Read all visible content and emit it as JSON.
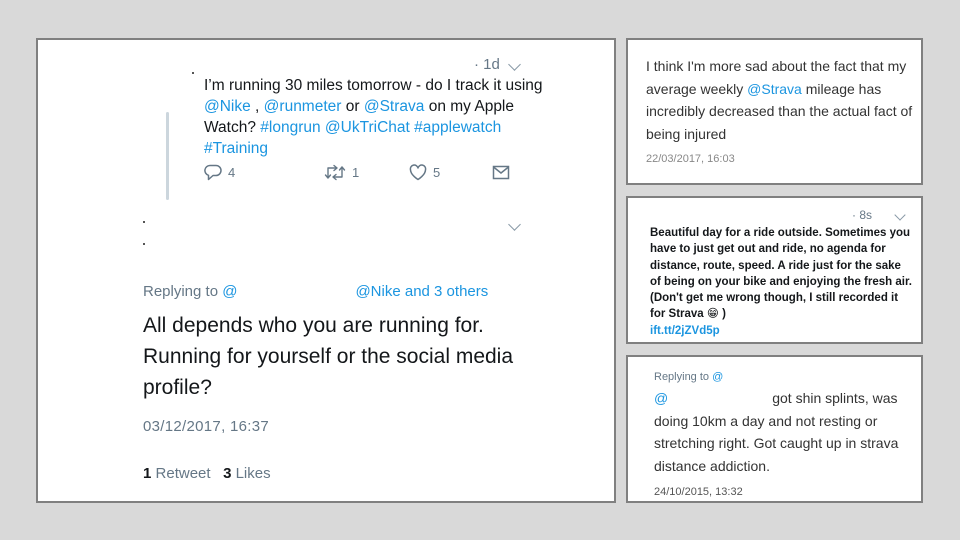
{
  "main": {
    "quoted": {
      "time": "· 1d",
      "text_1": "I’m running 30 miles tomorrow - do I track it using ",
      "mention_nike": "@Nike",
      "text_2": " , ",
      "mention_runmeter": "@runmeter",
      "text_3": " or ",
      "mention_strava": "@Strava",
      "text_4": " on my Apple Watch? ",
      "hashtag_longrun": "#longrun",
      "text_5": " ",
      "mention_uktrichat": "@UkTriChat",
      "text_6": " ",
      "hashtag_applewatch": "#applewatch",
      "text_7": " ",
      "hashtag_training": "#Training",
      "reply_count": "4",
      "retweet_count": "1",
      "like_count": "5"
    },
    "reply": {
      "replying_prefix": "Replying to ",
      "replying_handle": "@",
      "replying_others": "@Nike and 3 others",
      "text": "All depends who you are running for. Running for yourself or the social media profile?",
      "date": "03/12/2017, 16:37",
      "retweets_count": "1",
      "retweets_label": "Retweet",
      "likes_count": "3",
      "likes_label": "Likes"
    }
  },
  "panel1": {
    "text_1": "I think I'm more sad about the fact that my average weekly ",
    "mention": "@Strava",
    "text_2": " mileage has incredibly decreased than the actual fact of being injured",
    "date": "22/03/2017, 16:03"
  },
  "panel2": {
    "time": "· 8s",
    "text": "Beautiful day for a ride outside. Sometimes you have to just get out and ride, no agenda for distance, route, speed. A ride just for the sake of being on your bike and enjoying the fresh air. (Don't get me wrong though, I still recorded it for Strava",
    "emoji": "😁",
    "text_end": " )",
    "link": "ift.tt/2jZVd5p"
  },
  "panel3": {
    "replying_prefix": "Replying to ",
    "replying_handle": "@",
    "mention": "@",
    "text": "got shin splints, was doing 10km a day and not resting or stretching right. Got caught up in strava distance addiction.",
    "date": "24/10/2015, 13:32"
  },
  "colors": {
    "link": "#1b95e0",
    "muted": "#657786",
    "panel_border": "#808080",
    "background": "#d9d9d9"
  },
  "icons": [
    "reply-icon",
    "retweet-icon",
    "like-icon",
    "message-icon",
    "chevron-down-icon"
  ]
}
